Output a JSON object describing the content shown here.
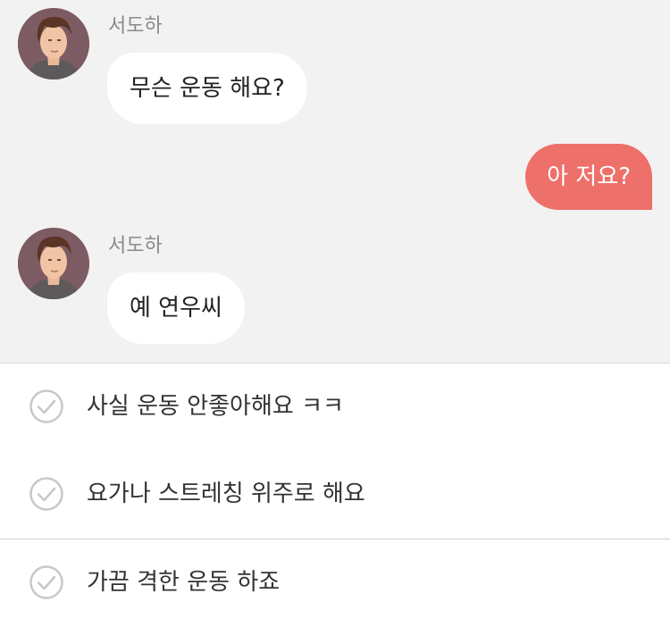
{
  "messages": [
    {
      "sender": "서도하",
      "text": "무슨 운동 해요?",
      "direction": "incoming"
    },
    {
      "text": "아 저요?",
      "direction": "outgoing"
    },
    {
      "sender": "서도하",
      "text": "예 연우씨",
      "direction": "incoming"
    }
  ],
  "choices": [
    {
      "label": "사실 운동 안좋아해요 ㅋㅋ",
      "icon": "check-circle-icon"
    },
    {
      "label": "요가나 스트레칭 위주로 해요",
      "icon": "check-circle-icon"
    },
    {
      "label": "가끔 격한 운동 하죠",
      "icon": "check-circle-icon"
    }
  ],
  "colors": {
    "outgoing_bubble": "#ee706b",
    "incoming_bubble": "#ffffff",
    "chat_background": "#f2f2f2"
  }
}
